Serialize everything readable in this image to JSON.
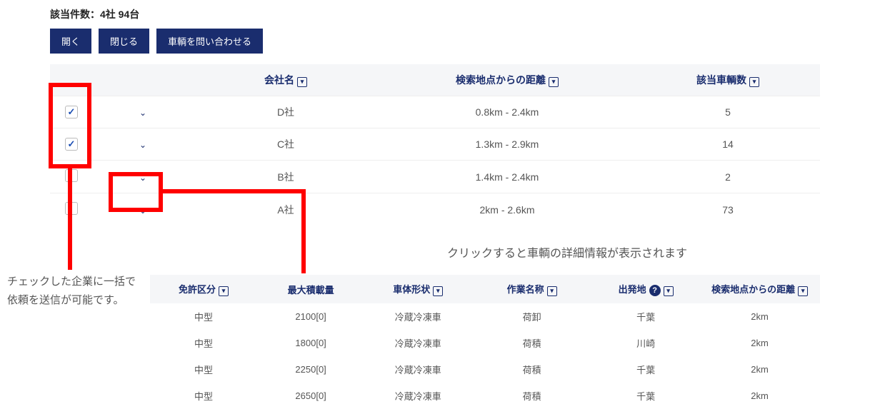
{
  "summary": "該当件数：4社 94台",
  "toolbar": {
    "open": "開く",
    "close": "閉じる",
    "inquire": "車輌を問い合わせる"
  },
  "table1": {
    "headers": {
      "company": "会社名",
      "distance": "検索地点からの距離",
      "count": "該当車輌数"
    },
    "rows": [
      {
        "checked": true,
        "company": "D社",
        "distance": "0.8km - 2.4km",
        "count": "5"
      },
      {
        "checked": true,
        "company": "C社",
        "distance": "1.3km - 2.9km",
        "count": "14"
      },
      {
        "checked": false,
        "company": "B社",
        "distance": "1.4km - 2.4km",
        "count": "2"
      },
      {
        "checked": false,
        "company": "A社",
        "distance": "2km - 2.6km",
        "count": "73"
      }
    ]
  },
  "caption1": "クリックすると車輌の詳細情報が表示されます",
  "note": "チェックした企業に一括で依頼を送信が可能です。",
  "table2": {
    "headers": {
      "license": "免許区分",
      "maxload": "最大積載量",
      "body": "車体形状",
      "work": "作業名称",
      "origin": "出発地",
      "distance": "検索地点からの距離"
    },
    "rows": [
      {
        "license": "中型",
        "maxload": "2100[0]",
        "body": "冷蔵冷凍車",
        "work": "荷卸",
        "origin": "千葉",
        "distance": "2km"
      },
      {
        "license": "中型",
        "maxload": "1800[0]",
        "body": "冷蔵冷凍車",
        "work": "荷積",
        "origin": "川崎",
        "distance": "2km"
      },
      {
        "license": "中型",
        "maxload": "2250[0]",
        "body": "冷蔵冷凍車",
        "work": "荷積",
        "origin": "千葉",
        "distance": "2km"
      },
      {
        "license": "中型",
        "maxload": "2650[0]",
        "body": "冷蔵冷凍車",
        "work": "荷積",
        "origin": "千葉",
        "distance": "2km"
      }
    ]
  }
}
